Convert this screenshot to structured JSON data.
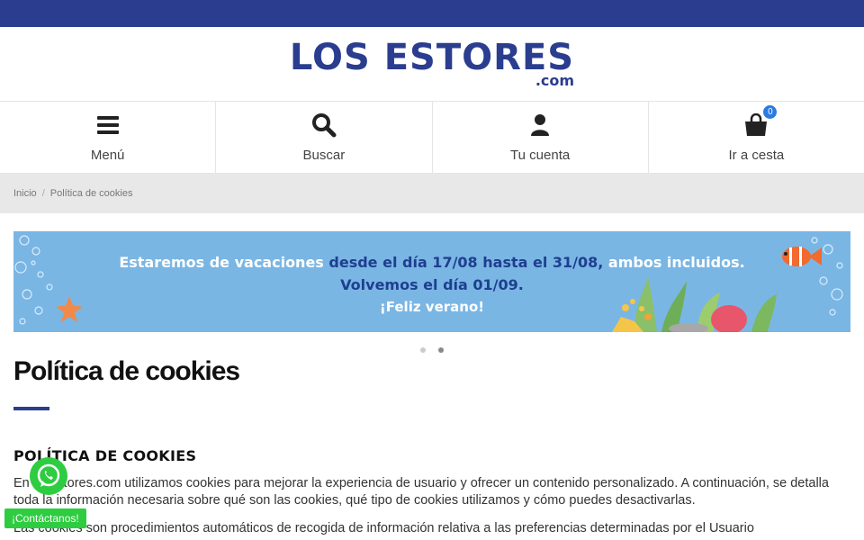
{
  "logo": {
    "main": "LOS ESTORES",
    "sub": ".com"
  },
  "nav": [
    {
      "icon": "menu-icon",
      "label": "Menú"
    },
    {
      "icon": "search-icon",
      "label": "Buscar"
    },
    {
      "icon": "user-icon",
      "label": "Tu cuenta"
    },
    {
      "icon": "shopping-bag-icon",
      "label": "Ir a cesta",
      "badge": "0"
    }
  ],
  "breadcrumb": {
    "home": "Inicio",
    "separator": "/",
    "current": "Política de cookies"
  },
  "banner": {
    "line1_a": "Estaremos de vacaciones ",
    "line1_b": "desde el día 17/08 hasta el 31/08,",
    "line1_c": " ambos incluidos.",
    "line2": "Volvemos el día 01/09.",
    "line3": "¡Feliz verano!"
  },
  "carousel": {
    "slides": 2,
    "active": 2
  },
  "page": {
    "title": "Política de cookies",
    "section_heading": "POLÍTICA DE COOKIES",
    "paragraph1": "En losestores.com utilizamos cookies para mejorar la experiencia de usuario y ofrecer un contenido personalizado. A continuación, se detalla toda la información necesaria sobre qué son las cookies, qué tipo de cookies utilizamos y cómo puedes desactivarlas.",
    "paragraph2": "Las cookies son procedimientos automáticos de recogida de información relativa a las preferencias determinadas por el Usuario"
  },
  "whatsapp": {
    "icon": "whatsapp-icon",
    "label": "¡Contáctanos!"
  },
  "colors": {
    "brand": "#2a3d8f",
    "banner_bg": "#7ab6e4",
    "whatsapp": "#2ecc40",
    "badge": "#2a7be4"
  }
}
